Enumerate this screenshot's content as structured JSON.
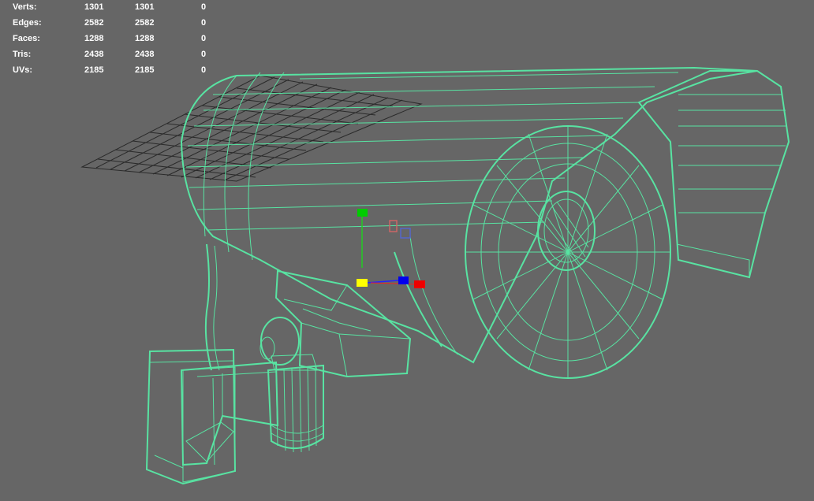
{
  "stats": [
    {
      "label": "Verts:",
      "values": [
        "1301",
        "1301",
        "0"
      ]
    },
    {
      "label": "Edges:",
      "values": [
        "2582",
        "2582",
        "0"
      ]
    },
    {
      "label": "Faces:",
      "values": [
        "1288",
        "1288",
        "0"
      ]
    },
    {
      "label": "Tris:",
      "values": [
        "2438",
        "2438",
        "0"
      ]
    },
    {
      "label": "UVs:",
      "values": [
        "2185",
        "2185",
        "0"
      ]
    }
  ],
  "colors": {
    "viewport_bg": "#666666",
    "wireframe": "#58e3a2",
    "hud_text": "#ffffff",
    "gizmo_x": "#ff0000",
    "gizmo_y": "#00cc00",
    "gizmo_z": "#0000ff",
    "gizmo_center": "#ffff00"
  },
  "icons": [
    "move-manipulator-icon",
    "ground-grid"
  ]
}
